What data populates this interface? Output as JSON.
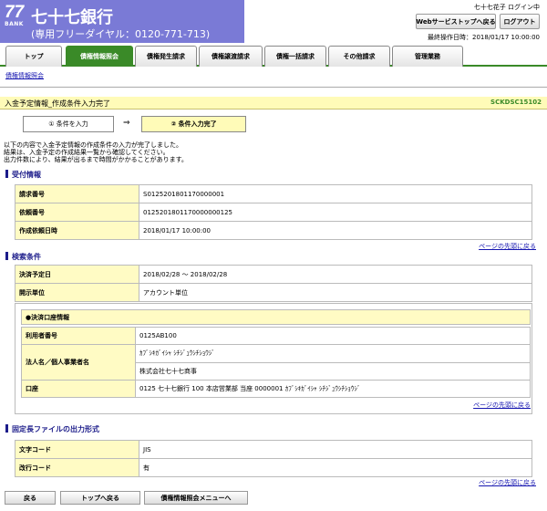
{
  "header": {
    "logo_number": "77",
    "logo_bank": "BANK",
    "bank_name": "七十七銀行",
    "freedial": "(専用フリーダイヤル：0120-771-713)",
    "user_status": "七十七花子 ログイン中",
    "webtop_label": "Webサービストップへ戻る",
    "logout_label": "ログアウト",
    "last_operation": "最終操作日時：2018/01/17 10:00:00"
  },
  "tabs": [
    "トップ",
    "債権情報照会",
    "債権発生請求",
    "債権譲渡請求",
    "債権一括請求",
    "その他請求",
    "管理業務"
  ],
  "active_tab": "債権情報照会",
  "subtab": "債権情報照会",
  "title": {
    "text": "入金予定情報_作成条件入力完了",
    "screen_id": "SCKDSC15102"
  },
  "steps": {
    "step1": "① 条件を入力",
    "arrow": "⇒",
    "step2": "② 条件入力完了"
  },
  "message": [
    "以下の内容で入金予定情報の作成条件の入力が完了しました。",
    "結果は、入金予定の作成結果一覧から確認してください。",
    "出力件数により、結果が出るまで時間がかかることがあります。"
  ],
  "receipt": {
    "heading": "受付情報",
    "rows": [
      {
        "label": "請求番号",
        "value": "S0125201801170000001"
      },
      {
        "label": "依頼番号",
        "value": "0125201801170000000125"
      },
      {
        "label": "作成依頼日時",
        "value": "2018/01/17 10:00:00"
      }
    ]
  },
  "to_top_link": "ページの先頭に戻る",
  "search": {
    "heading": "検索条件",
    "rows": [
      {
        "label": "決済予定日",
        "value": "2018/02/28 ～ 2018/02/28"
      },
      {
        "label": "開示単位",
        "value": "アカウント単位"
      }
    ],
    "account": {
      "heading": "●決済口座情報",
      "user_number_label": "利用者番号",
      "user_number": "0125AB100",
      "name_label": "法人名／個人事業者名",
      "name_kana": "ｶﾌﾞｼｷｶﾞｲｼｬ ｼﾁｼﾞｭｳｼﾁｼｮｳｼﾞ",
      "name": "株式会社七十七商事",
      "account_label": "口座",
      "account": "0125 七十七銀行 100 本店営業部 当座 0000001 ｶﾌﾞｼｷｶﾞｲｼｬ ｼﾁｼﾞｭｳｼﾁｼｮｳｼﾞ"
    }
  },
  "output": {
    "heading": "固定長ファイルの出力形式",
    "rows": [
      {
        "label": "文字コード",
        "value": "JIS"
      },
      {
        "label": "改行コード",
        "value": "有"
      }
    ]
  },
  "buttons": {
    "back": "戻る",
    "top": "トップへ戻る",
    "menu": "債権情報照会メニューへ"
  }
}
